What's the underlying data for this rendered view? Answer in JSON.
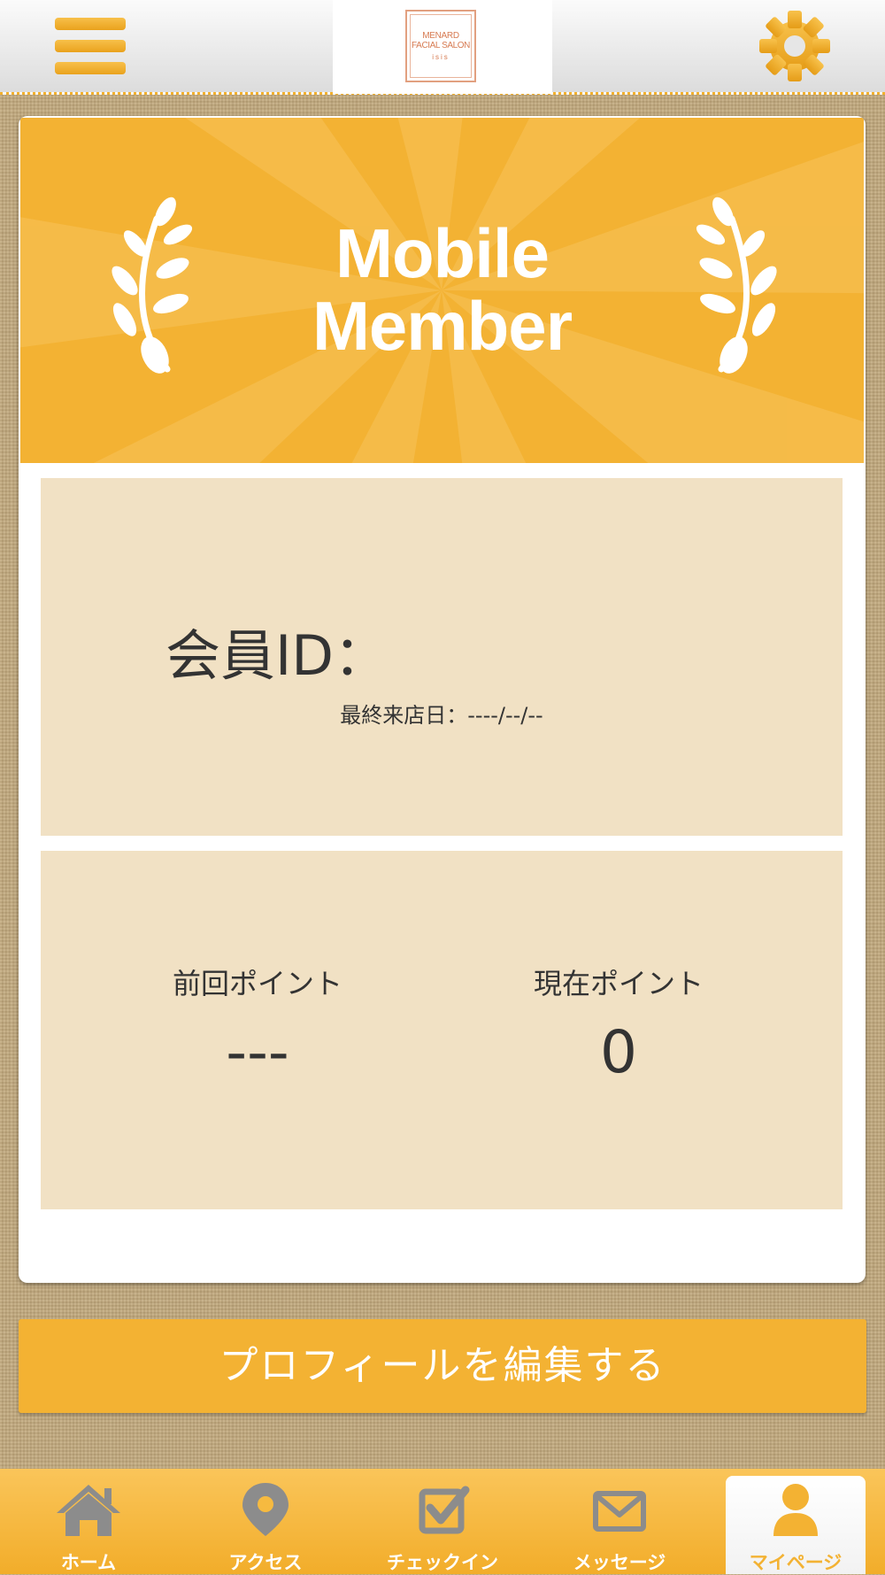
{
  "header": {
    "menu_icon": "hamburger-menu-icon",
    "logo": {
      "line1": "MENARD",
      "line2": "FACIAL SALON",
      "line3": "isis"
    },
    "settings_icon": "gear-icon"
  },
  "banner": {
    "title": "Mobile\nMember",
    "decoration_icon": "laurel-icon"
  },
  "member": {
    "id_label": "会員ID：",
    "last_visit": "最終来店日：----/--/--"
  },
  "points": {
    "previous_label": "前回ポイント",
    "previous_value": "---",
    "current_label": "現在ポイント",
    "current_value": "0"
  },
  "profile_button": "プロフィールを編集する",
  "tabs": [
    {
      "label": "ホーム",
      "icon": "home-icon"
    },
    {
      "label": "アクセス",
      "icon": "map-pin-icon"
    },
    {
      "label": "チェックイン",
      "icon": "checkbox-icon"
    },
    {
      "label": "メッセージ",
      "icon": "envelope-icon"
    },
    {
      "label": "マイページ",
      "icon": "person-icon",
      "active": true
    }
  ],
  "colors": {
    "accent": "#f3b233",
    "panel": "#f1e1c4",
    "text": "#333333",
    "icon_gray": "#8c8c8c"
  }
}
